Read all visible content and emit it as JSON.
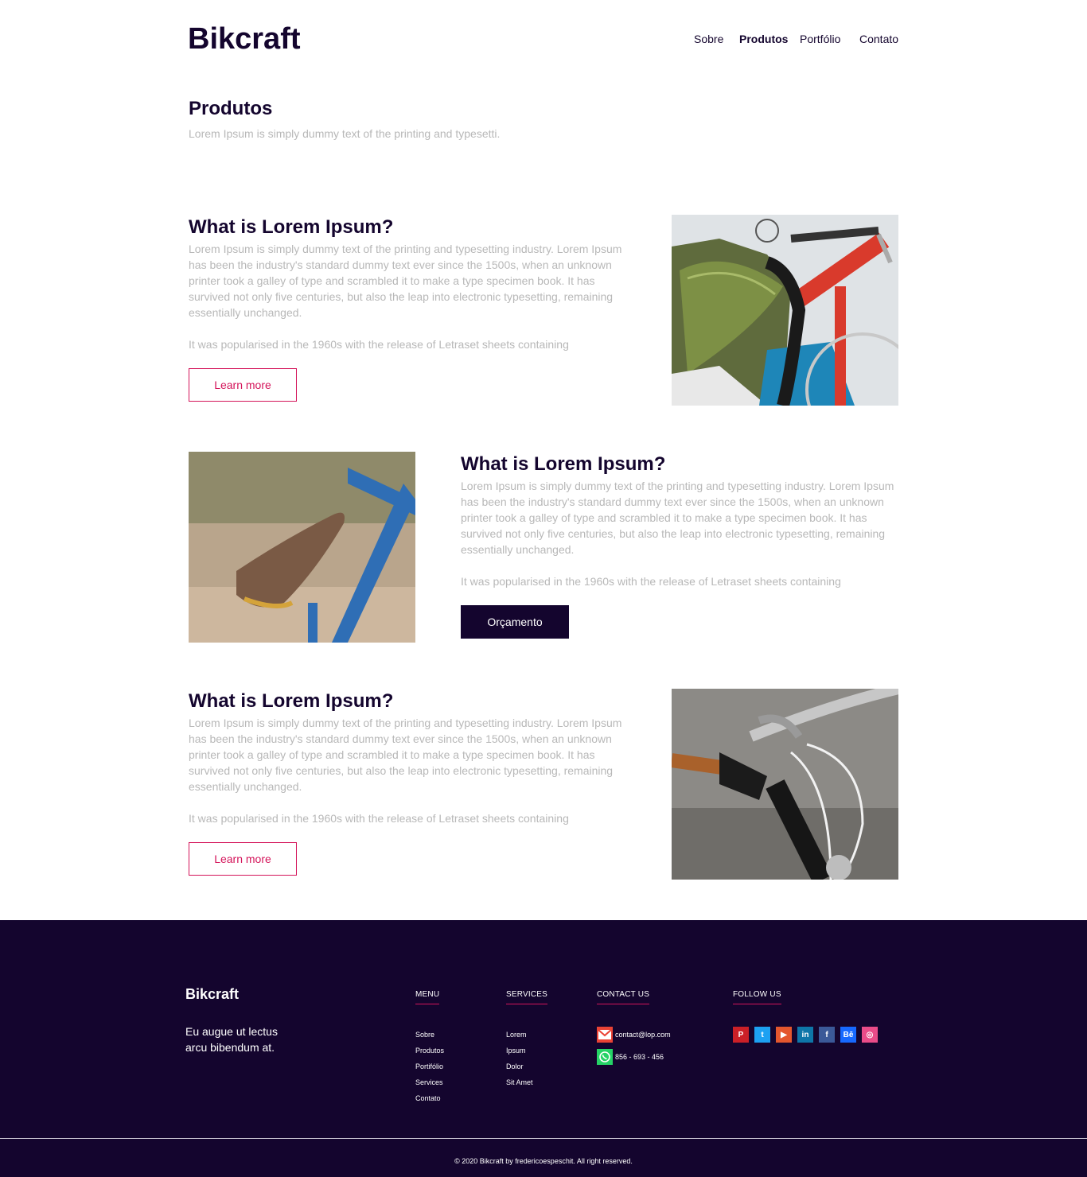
{
  "header": {
    "logo": "Bikcraft",
    "nav": [
      "Sobre",
      "Produtos",
      "Portfólio",
      "Contato"
    ]
  },
  "intro": {
    "title": "Produtos",
    "subtitle": "Lorem Ipsum is simply dummy text of the printing and typesetti."
  },
  "products": [
    {
      "title": "What is Lorem Ipsum?",
      "body": "Lorem Ipsum is simply dummy text of the printing and typesetting industry. Lorem Ipsum has been the industry's standard dummy text ever since the 1500s, when an unknown printer took a galley of type and scrambled it to make a type specimen book. It has survived not only five centuries, but also the leap into electronic typesetting, remaining essentially unchanged.",
      "body2": "It was popularised in the 1960s with the release of Letraset sheets containing",
      "button": "Learn more"
    },
    {
      "title": "What is Lorem Ipsum?",
      "body": "Lorem Ipsum is simply dummy text of the printing and typesetting industry. Lorem Ipsum has been the industry's standard dummy text ever since the 1500s, when an unknown printer took a galley of type and scrambled it to make a type specimen book. It has survived not only five centuries, but also the leap into electronic typesetting, remaining essentially unchanged.",
      "body2": "It was popularised in the 1960s with the release of Letraset sheets containing",
      "button": "Orçamento"
    },
    {
      "title": "What is Lorem Ipsum?",
      "body": "Lorem Ipsum is simply dummy text of the printing and typesetting industry. Lorem Ipsum has been the industry's standard dummy text ever since the 1500s, when an unknown printer took a galley of type and scrambled it to make a type specimen book. It has survived not only five centuries, but also the leap into electronic typesetting, remaining essentially unchanged.",
      "body2": "It was popularised in the 1960s with the release of Letraset sheets containing",
      "button": "Learn more"
    }
  ],
  "footer": {
    "brand": "Bikcraft",
    "description": "Eu augue ut lectus arcu bibendum at.",
    "menu": {
      "heading": "MENU",
      "items": [
        "Sobre",
        "Produtos",
        "Portifólio",
        "Services",
        "Contato"
      ]
    },
    "services": {
      "heading": "SERVICES",
      "items": [
        "Lorem",
        "Ipsum",
        "Dolor",
        "Sit Amet"
      ]
    },
    "contact": {
      "heading": "CONTACT US",
      "email": "contact@lop.com",
      "phone": "856 - 693 - 456"
    },
    "follow": {
      "heading": "FOLLOW US",
      "icons": [
        "pinterest-icon",
        "twitter-icon",
        "youtube-icon",
        "linkedin-icon",
        "facebook-icon",
        "behance-icon",
        "dribbble-icon"
      ]
    },
    "copyright": "© 2020 Bikcraft by fredericoespeschit. All right reserved."
  },
  "colors": {
    "primary": "#14052e",
    "accent": "#d4145a",
    "muted": "#b8b8b8"
  }
}
